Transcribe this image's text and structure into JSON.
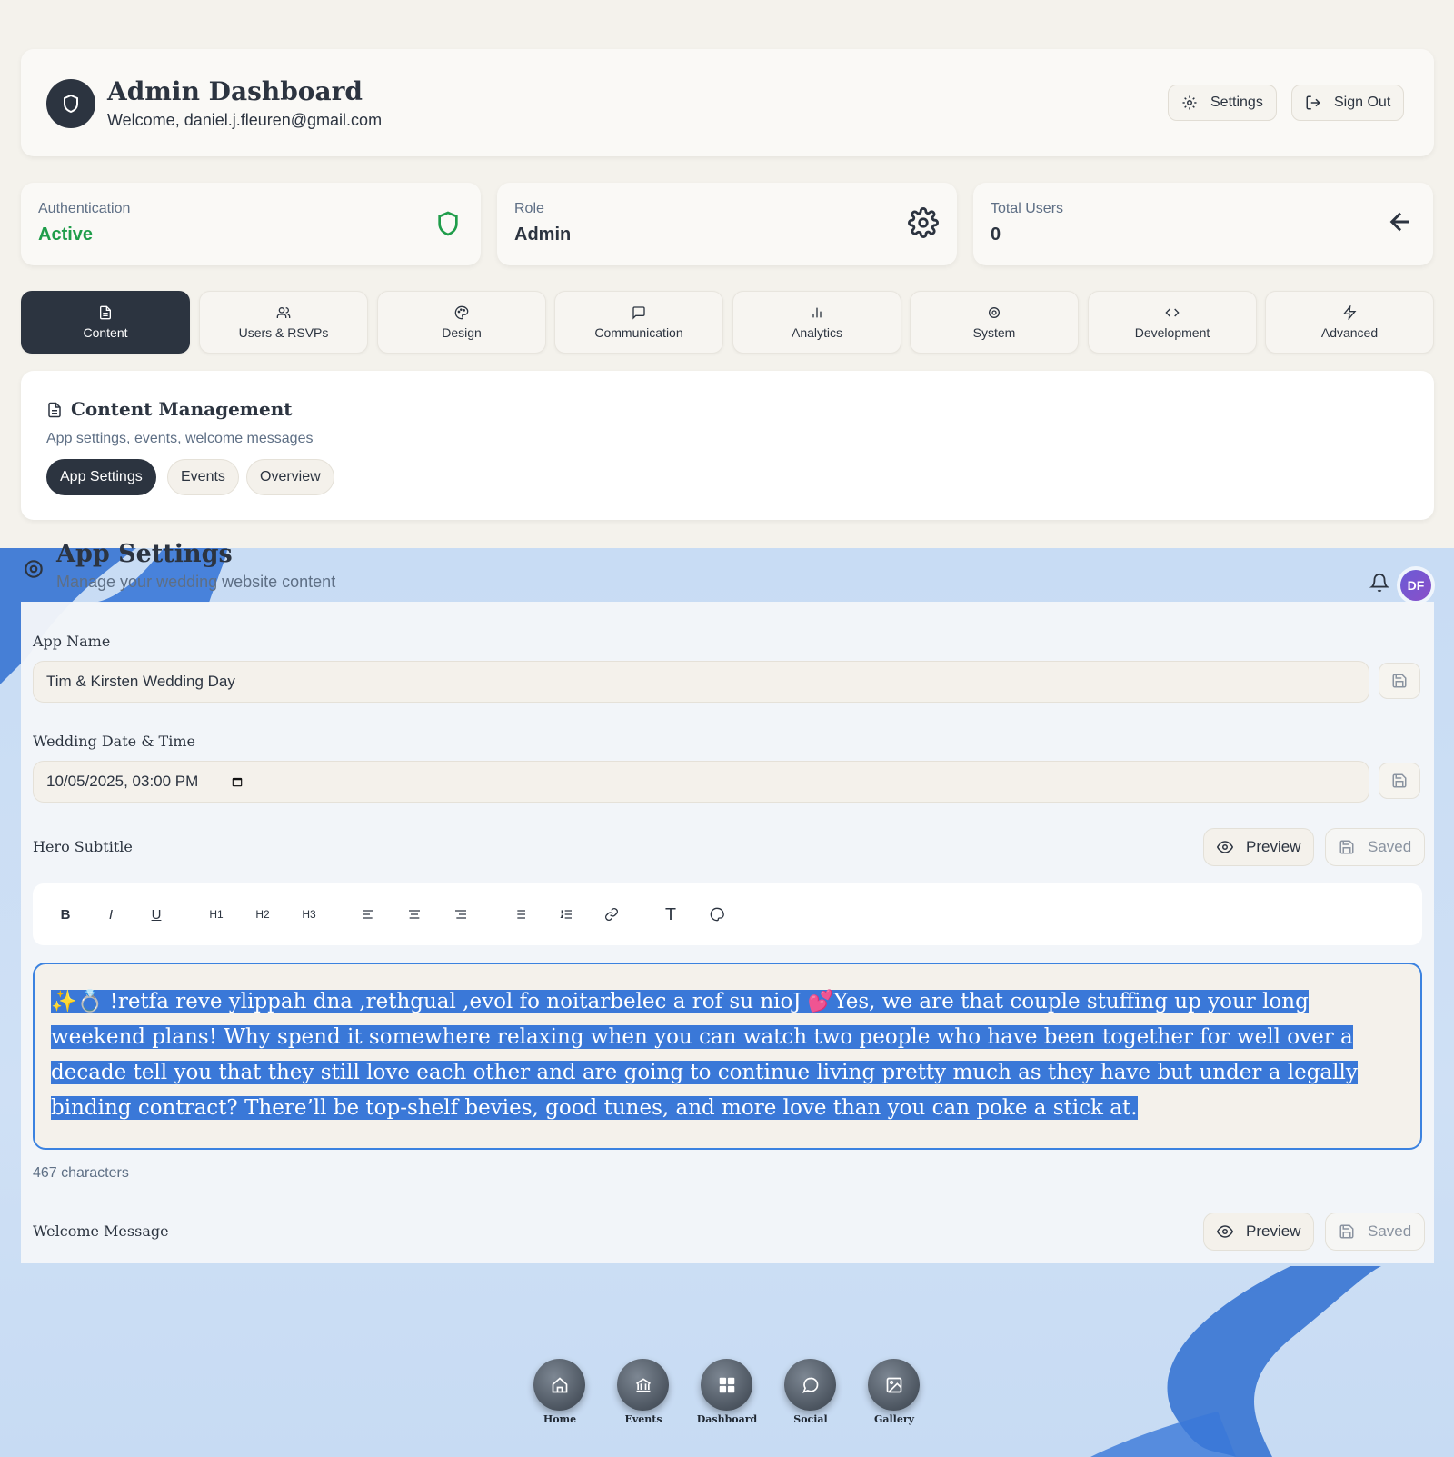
{
  "header": {
    "title": "Admin Dashboard",
    "welcome": "Welcome, daniel.j.fleuren@gmail.com",
    "settings_label": "Settings",
    "signout_label": "Sign Out"
  },
  "stats": [
    {
      "label": "Authentication",
      "value": "Active",
      "value_color": "#1f9d4a",
      "icon": "shield-icon"
    },
    {
      "label": "Role",
      "value": "Admin",
      "icon": "gear-icon"
    },
    {
      "label": "Total Users",
      "value": "0",
      "icon": "arrow-left-icon"
    }
  ],
  "tabs": [
    {
      "label": "Content",
      "icon": "document-icon",
      "active": true
    },
    {
      "label": "Users & RSVPs",
      "icon": "users-icon"
    },
    {
      "label": "Design",
      "icon": "palette-icon"
    },
    {
      "label": "Communication",
      "icon": "chat-icon"
    },
    {
      "label": "Analytics",
      "icon": "bar-chart-icon"
    },
    {
      "label": "System",
      "icon": "gear-icon"
    },
    {
      "label": "Development",
      "icon": "code-icon"
    },
    {
      "label": "Advanced",
      "icon": "lightning-icon"
    }
  ],
  "content_management": {
    "title": "Content Management",
    "subtitle": "App settings, events, welcome messages",
    "pills": [
      "App Settings",
      "Events",
      "Overview"
    ]
  },
  "app_settings": {
    "title": "App Settings",
    "subtitle": "Manage your wedding website content",
    "avatar_initials": "DF",
    "fields": {
      "app_name_label": "App Name",
      "app_name_value": "Tim & Kirsten Wedding Day",
      "date_label": "Wedding Date & Time",
      "date_value": "10/05/2025, 03:00 PM",
      "hero_label": "Hero Subtitle",
      "preview_label": "Preview",
      "saved_label": "Saved",
      "hero_text_reversed": "✨💍 !retfa reve ylippah dna ,rethgual ,evol fo noitarbelec a rof su nioJ 💕",
      "hero_text": "Yes, we are that couple stuffing up your long weekend plans! Why spend it somewhere relaxing when you can watch two people who have been together for well over a decade tell you that they still love each other and are going to continue living pretty much as they have but under a legally binding contract? There’ll be top-shelf bevies, good tunes, and more love than you can poke a stick at.",
      "char_count": "467 characters",
      "welcome_label": "Welcome Message"
    }
  },
  "toolbar": {
    "h1": "H1",
    "h2": "H2",
    "h3": "H3"
  },
  "bottom_nav": [
    {
      "label": "Home",
      "icon": "home-icon"
    },
    {
      "label": "Events",
      "icon": "bank-icon"
    },
    {
      "label": "Dashboard",
      "icon": "grid-icon"
    },
    {
      "label": "Social",
      "icon": "chat-icon"
    },
    {
      "label": "Gallery",
      "icon": "image-icon"
    }
  ],
  "colors": {
    "primary": "#2c3440",
    "accent_blue": "#3b82e0",
    "active_green": "#1f9d4a",
    "background": "#f4f2ec"
  }
}
